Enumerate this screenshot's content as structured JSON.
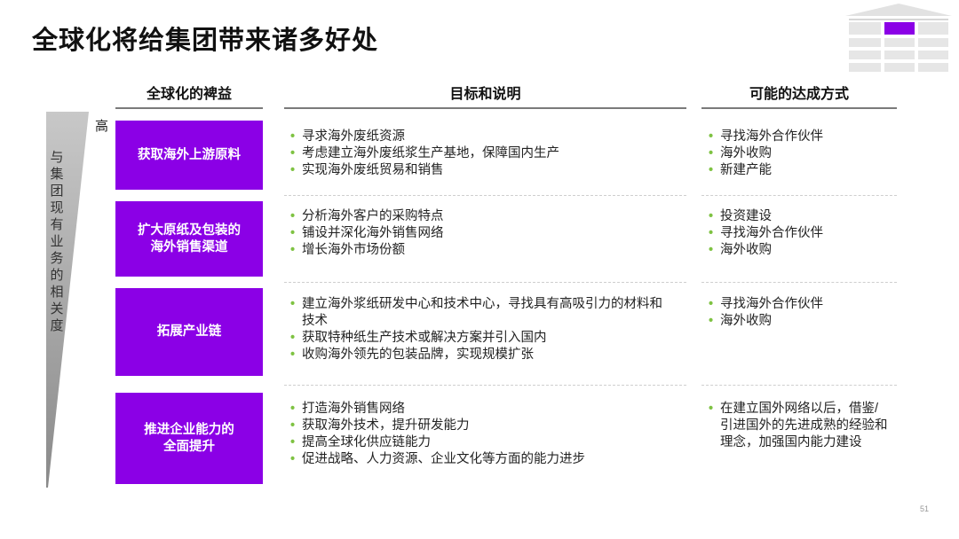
{
  "slide": {
    "title": "全球化将给集团带来诸多好处",
    "page_number": "51",
    "accent_color": "#8b00e6",
    "bullet_color": "#7ec242"
  },
  "headers": {
    "benefit": "全球化的裨益",
    "goal": "目标和说明",
    "method": "可能的达成方式"
  },
  "axis": {
    "side_label": "与集团现有业务的相关度",
    "high": "高"
  },
  "rows": [
    {
      "benefit": "获取海外上游原料",
      "goals": [
        "寻求海外废纸资源",
        "考虑建立海外废纸浆生产基地，保障国内生产",
        "实现海外废纸贸易和销售"
      ],
      "methods": [
        "寻找海外合作伙伴",
        "海外收购",
        "新建产能"
      ]
    },
    {
      "benefit": "扩大原纸及包装的\n海外销售渠道",
      "goals": [
        "分析海外客户的采购特点",
        "铺设并深化海外销售网络",
        "增长海外市场份额"
      ],
      "methods": [
        "投资建设",
        "寻找海外合作伙伴",
        "海外收购"
      ]
    },
    {
      "benefit": "拓展产业链",
      "goals": [
        "建立海外浆纸研发中心和技术中心，寻找具有高吸引力的材料和技术",
        "获取特种纸生产技术或解决方案并引入国内",
        "收购海外领先的包装品牌，实现规模扩张"
      ],
      "methods": [
        "寻找海外合作伙伴",
        "海外收购"
      ]
    },
    {
      "benefit": "推进企业能力的\n全面提升",
      "goals": [
        "打造海外销售网络",
        "获取海外技术，提升研发能力",
        "提高全球化供应链能力",
        "促进战略、人力资源、企业文化等方面的能力进步"
      ],
      "methods": [
        "在建立国外网络以后，借鉴/引进国外的先进成熟的经验和理念，加强国内能力建设"
      ]
    }
  ]
}
